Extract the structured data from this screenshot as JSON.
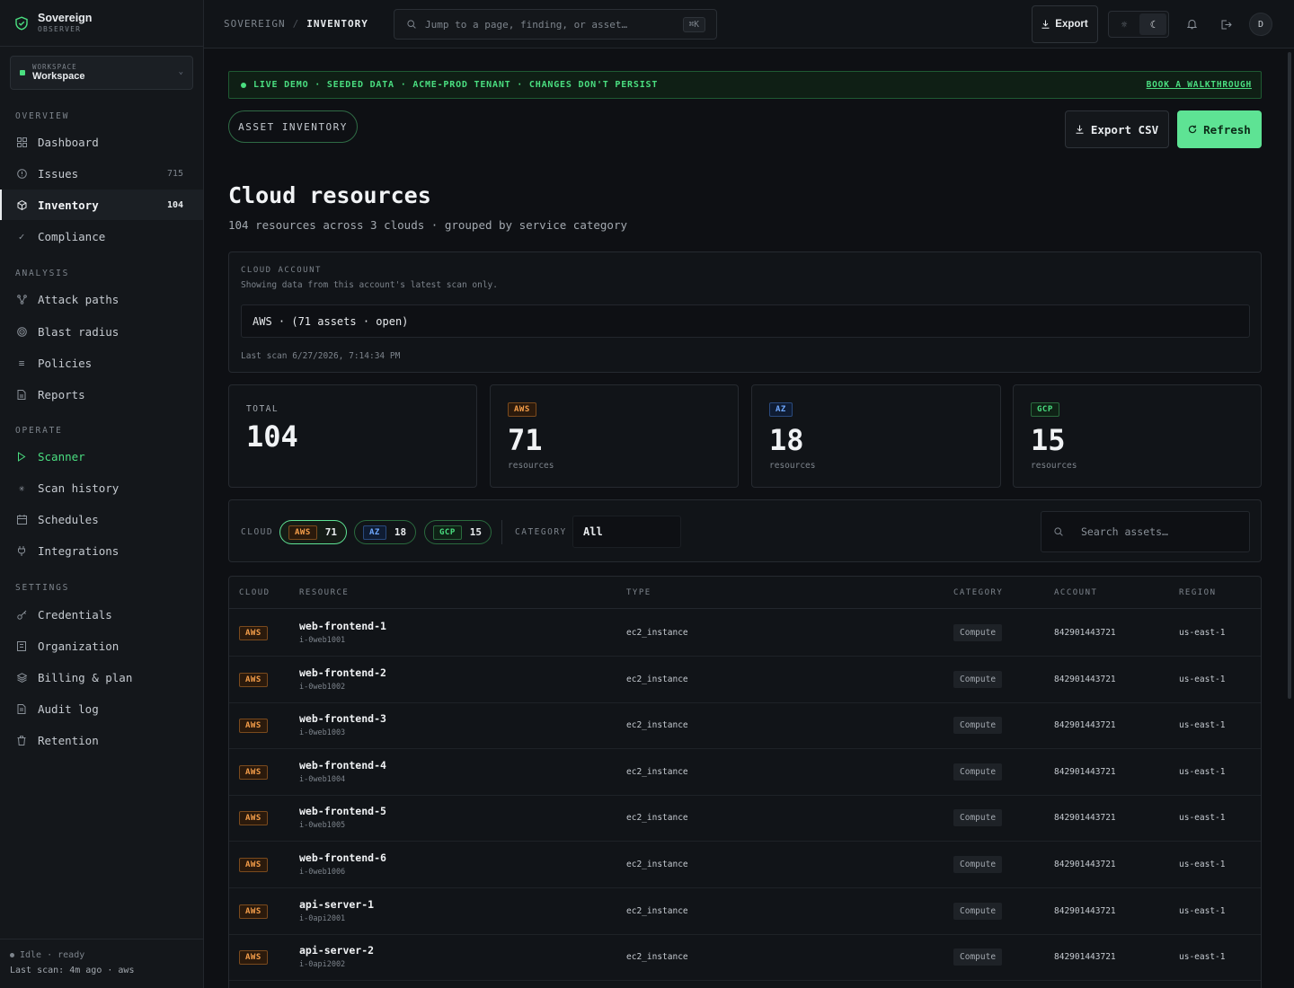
{
  "brand": {
    "name": "Sovereign",
    "sub": "OBSERVER"
  },
  "workspace": {
    "label": "WORKSPACE",
    "name": "Workspace"
  },
  "nav": {
    "overview_label": "OVERVIEW",
    "analysis_label": "ANALYSIS",
    "operate_label": "OPERATE",
    "settings_label": "SETTINGS",
    "dashboard": "Dashboard",
    "issues": "Issues",
    "issues_count": "715",
    "inventory": "Inventory",
    "inventory_count": "104",
    "compliance": "Compliance",
    "attack_paths": "Attack paths",
    "blast_radius": "Blast radius",
    "policies": "Policies",
    "reports": "Reports",
    "scanner": "Scanner",
    "scan_history": "Scan history",
    "schedules": "Schedules",
    "integrations": "Integrations",
    "credentials": "Credentials",
    "organization": "Organization",
    "billing": "Billing & plan",
    "audit_log": "Audit log",
    "retention": "Retention"
  },
  "sidebar_footer": {
    "status": "Idle · ready",
    "last_scan": "Last scan: 4m ago · aws"
  },
  "topbar": {
    "crumb_root": "SOVEREIGN",
    "crumb_sep": "/",
    "crumb_current": "INVENTORY",
    "search_placeholder": "Jump to a page, finding, or asset…",
    "shortcut": "⌘K",
    "export_label": "Export",
    "avatar_initial": "D"
  },
  "banner": {
    "text": "LIVE DEMO · SEEDED DATA · ACME-PROD TENANT · CHANGES DON'T PERSIST",
    "link": "BOOK A WALKTHROUGH"
  },
  "page": {
    "tag": "ASSET INVENTORY",
    "export_csv": "Export CSV",
    "refresh": "Refresh",
    "title": "Cloud resources",
    "subtitle": "104 resources across 3 clouds · grouped by service category"
  },
  "account": {
    "label": "CLOUD ACCOUNT",
    "description": "Showing data from this account's latest scan only.",
    "selected": "AWS · (71 assets · open)",
    "last_scan": "Last scan 6/27/2026, 7:14:34 PM"
  },
  "stats": {
    "total_label": "TOTAL",
    "total_value": "104",
    "aws_badge": "AWS",
    "aws_value": "71",
    "az_badge": "AZ",
    "az_value": "18",
    "gcp_badge": "GCP",
    "gcp_value": "15",
    "unit": "resources"
  },
  "filters": {
    "cloud_label": "CLOUD",
    "chips": [
      {
        "badge": "AWS",
        "count": "71"
      },
      {
        "badge": "AZ",
        "count": "18"
      },
      {
        "badge": "GCP",
        "count": "15"
      }
    ],
    "category_label": "CATEGORY",
    "category_value": "All",
    "search_placeholder": "Search assets…"
  },
  "table": {
    "columns": [
      "CLOUD",
      "RESOURCE",
      "TYPE",
      "CATEGORY",
      "ACCOUNT",
      "REGION"
    ],
    "rows": [
      {
        "cloud": "AWS",
        "name": "web-frontend-1",
        "id": "i-0web1001",
        "type": "ec2_instance",
        "category": "Compute",
        "account": "842901443721",
        "region": "us-east-1"
      },
      {
        "cloud": "AWS",
        "name": "web-frontend-2",
        "id": "i-0web1002",
        "type": "ec2_instance",
        "category": "Compute",
        "account": "842901443721",
        "region": "us-east-1"
      },
      {
        "cloud": "AWS",
        "name": "web-frontend-3",
        "id": "i-0web1003",
        "type": "ec2_instance",
        "category": "Compute",
        "account": "842901443721",
        "region": "us-east-1"
      },
      {
        "cloud": "AWS",
        "name": "web-frontend-4",
        "id": "i-0web1004",
        "type": "ec2_instance",
        "category": "Compute",
        "account": "842901443721",
        "region": "us-east-1"
      },
      {
        "cloud": "AWS",
        "name": "web-frontend-5",
        "id": "i-0web1005",
        "type": "ec2_instance",
        "category": "Compute",
        "account": "842901443721",
        "region": "us-east-1"
      },
      {
        "cloud": "AWS",
        "name": "web-frontend-6",
        "id": "i-0web1006",
        "type": "ec2_instance",
        "category": "Compute",
        "account": "842901443721",
        "region": "us-east-1"
      },
      {
        "cloud": "AWS",
        "name": "api-server-1",
        "id": "i-0api2001",
        "type": "ec2_instance",
        "category": "Compute",
        "account": "842901443721",
        "region": "us-east-1"
      },
      {
        "cloud": "AWS",
        "name": "api-server-2",
        "id": "i-0api2002",
        "type": "ec2_instance",
        "category": "Compute",
        "account": "842901443721",
        "region": "us-east-1"
      }
    ]
  },
  "colors": {
    "accent": "#4ade80",
    "aws": "#f59e4a",
    "azure": "#6fa8ff",
    "gcp": "#4ade80",
    "background": "#0e1014"
  }
}
